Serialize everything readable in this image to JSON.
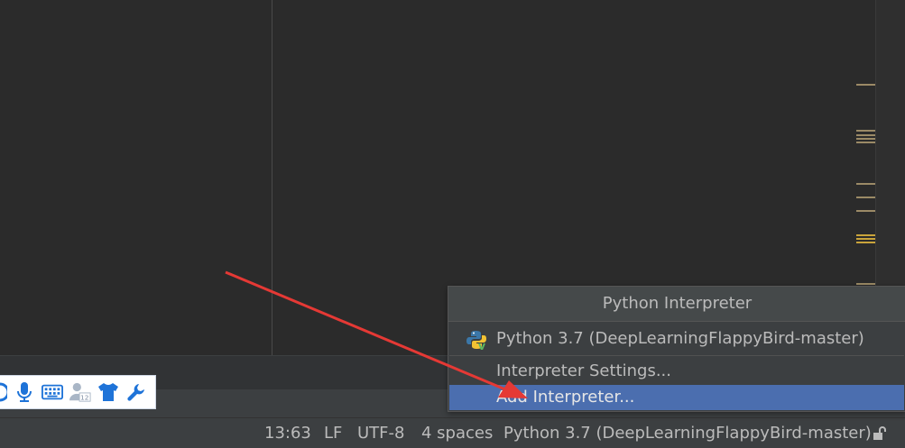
{
  "popup": {
    "title": "Python Interpreter",
    "items": [
      {
        "label": "Python 3.7 (DeepLearningFlappyBird-master)",
        "icon": "python-icon"
      },
      {
        "label": "Interpreter Settings..."
      },
      {
        "label": "Add Interpreter...",
        "selected": true
      }
    ]
  },
  "statusbar": {
    "position": "13:63",
    "line_separator": "LF",
    "encoding": "UTF-8",
    "indent": "4 spaces",
    "interpreter": "Python 3.7 (DeepLearningFlappyBird-master)",
    "lock_icon": "unlock-icon"
  },
  "ime_toolbar": {
    "icons": [
      "partial-circle-icon",
      "microphone-icon",
      "keyboard-icon",
      "user-badge-icon",
      "tshirt-icon",
      "wrench-icon"
    ]
  },
  "colors": {
    "selection": "#4b6eaf",
    "annotation_arrow": "#e53935",
    "ime_blue": "#1e73d8"
  }
}
